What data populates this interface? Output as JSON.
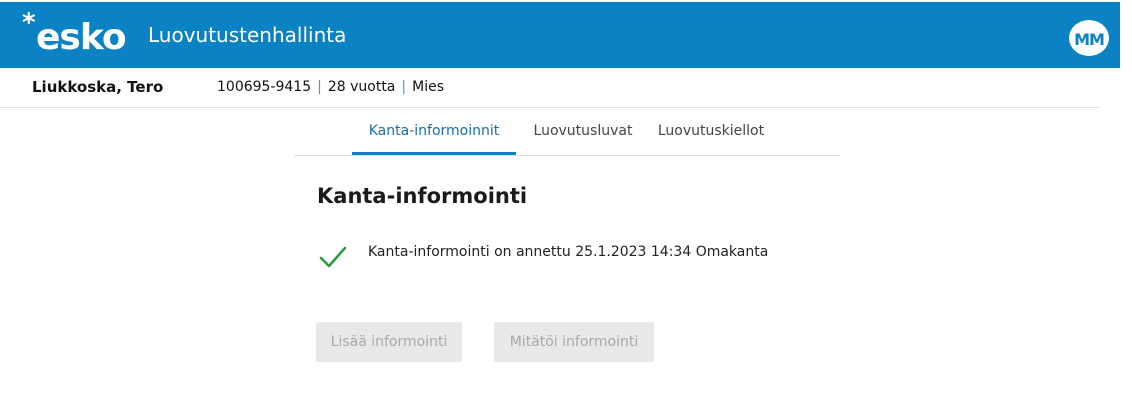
{
  "header": {
    "logo_text": "esko",
    "logo_star": "*",
    "app_title": "Luovutustenhallinta",
    "user_initials": "MM",
    "accent_color": "#0a82c4"
  },
  "patient": {
    "name": "Liukkoska, Tero",
    "id": "100695-9415",
    "age": "28 vuotta",
    "gender": "Mies"
  },
  "tabs": [
    {
      "label": "Kanta-informoinnit",
      "active": true
    },
    {
      "label": "Luovutusluvat",
      "active": false
    },
    {
      "label": "Luovutuskiellot",
      "active": false
    }
  ],
  "main": {
    "title": "Kanta-informointi",
    "status_icon": "check-icon",
    "status_color": "#2e9b3a",
    "status_text": "Kanta-informointi on annettu 25.1.2023 14:34 Omakanta",
    "buttons": {
      "add_label": "Lisää informointi",
      "cancel_label": "Mitätöi informointi",
      "disabled": true
    }
  }
}
